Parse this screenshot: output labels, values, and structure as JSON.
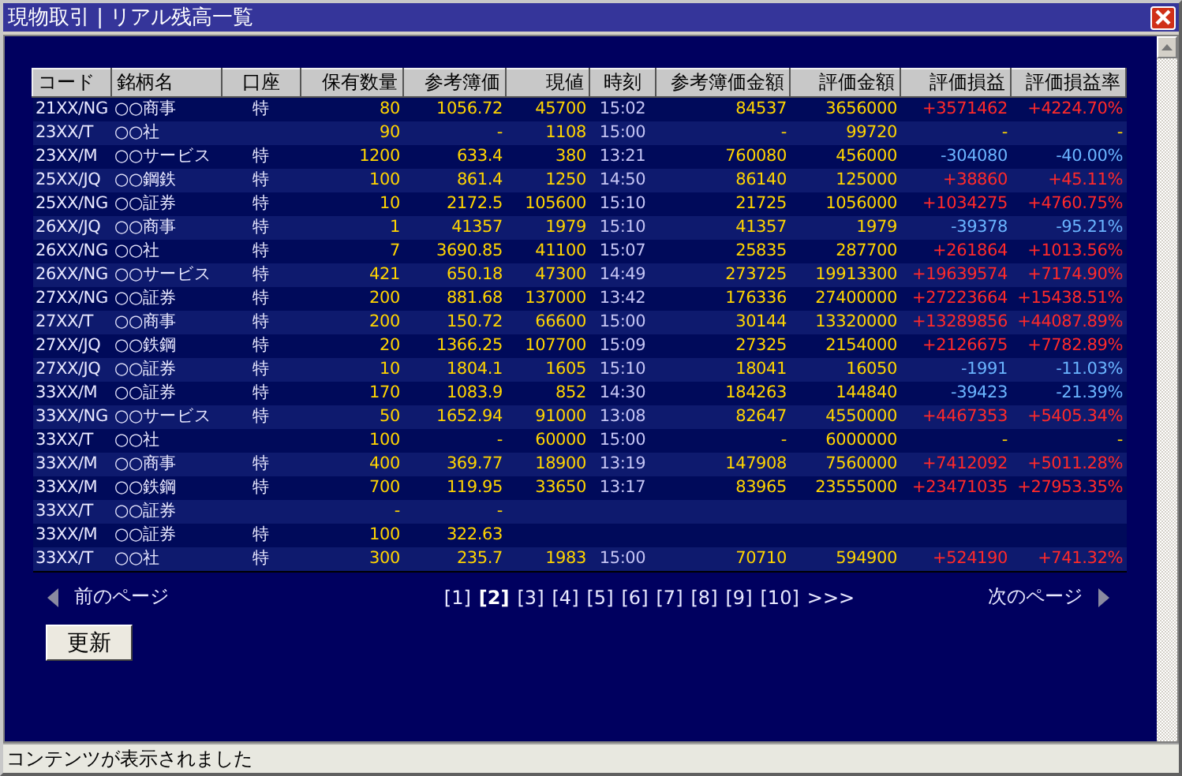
{
  "window": {
    "title": "現物取引 | リアル残高一覧"
  },
  "table": {
    "columns": [
      "コード",
      "銘柄名",
      "口座",
      "保有数量",
      "参考簿価",
      "現値",
      "時刻",
      "参考簿価金額",
      "評価金額",
      "評価損益",
      "評価損益率"
    ],
    "rows": [
      {
        "kind": "gain",
        "cells": [
          "21XX/NG",
          "○○商事",
          "特",
          "80",
          "1056.72",
          "45700",
          "15:02",
          "84537",
          "3656000",
          "+3571462",
          "+4224.70%"
        ]
      },
      {
        "kind": "flat",
        "cells": [
          "23XX/T",
          "○○社",
          null,
          "90",
          "-",
          "1108",
          "15:00",
          "-",
          "99720",
          "-",
          "-"
        ]
      },
      {
        "kind": "loss",
        "cells": [
          "23XX/M",
          "○○サービス",
          "特",
          "1200",
          "633.4",
          "380",
          "13:21",
          "760080",
          "456000",
          "-304080",
          "-40.00%"
        ]
      },
      {
        "kind": "gain",
        "cells": [
          "25XX/JQ",
          "○○鋼鉄",
          "特",
          "100",
          "861.4",
          "1250",
          "14:50",
          "86140",
          "125000",
          "+38860",
          "+45.11%"
        ]
      },
      {
        "kind": "gain",
        "cells": [
          "25XX/NG",
          "○○証券",
          "特",
          "10",
          "2172.5",
          "105600",
          "15:10",
          "21725",
          "1056000",
          "+1034275",
          "+4760.75%"
        ]
      },
      {
        "kind": "loss",
        "cells": [
          "26XX/JQ",
          "○○商事",
          "特",
          "1",
          "41357",
          "1979",
          "15:10",
          "41357",
          "1979",
          "-39378",
          "-95.21%"
        ]
      },
      {
        "kind": "gain",
        "cells": [
          "26XX/NG",
          "○○社",
          "特",
          "7",
          "3690.85",
          "41100",
          "15:07",
          "25835",
          "287700",
          "+261864",
          "+1013.56%"
        ]
      },
      {
        "kind": "gain",
        "cells": [
          "26XX/NG",
          "○○サービス",
          "特",
          "421",
          "650.18",
          "47300",
          "14:49",
          "273725",
          "19913300",
          "+19639574",
          "+7174.90%"
        ]
      },
      {
        "kind": "gain",
        "cells": [
          "27XX/NG",
          "○○証券",
          "特",
          "200",
          "881.68",
          "137000",
          "13:42",
          "176336",
          "27400000",
          "+27223664",
          "+15438.51%"
        ]
      },
      {
        "kind": "gain",
        "cells": [
          "27XX/T",
          "○○商事",
          "特",
          "200",
          "150.72",
          "66600",
          "15:00",
          "30144",
          "13320000",
          "+13289856",
          "+44087.89%"
        ]
      },
      {
        "kind": "gain",
        "cells": [
          "27XX/JQ",
          "○○鉄鋼",
          "特",
          "20",
          "1366.25",
          "107700",
          "15:09",
          "27325",
          "2154000",
          "+2126675",
          "+7782.89%"
        ]
      },
      {
        "kind": "loss",
        "cells": [
          "27XX/JQ",
          "○○証券",
          "特",
          "10",
          "1804.1",
          "1605",
          "15:10",
          "18041",
          "16050",
          "-1991",
          "-11.03%"
        ]
      },
      {
        "kind": "loss",
        "cells": [
          "33XX/M",
          "○○証券",
          "特",
          "170",
          "1083.9",
          "852",
          "14:30",
          "184263",
          "144840",
          "-39423",
          "-21.39%"
        ]
      },
      {
        "kind": "gain",
        "cells": [
          "33XX/NG",
          "○○サービス",
          "特",
          "50",
          "1652.94",
          "91000",
          "13:08",
          "82647",
          "4550000",
          "+4467353",
          "+5405.34%"
        ]
      },
      {
        "kind": "flat",
        "cells": [
          "33XX/T",
          "○○社",
          null,
          "100",
          "-",
          "60000",
          "15:00",
          "-",
          "6000000",
          "-",
          "-"
        ]
      },
      {
        "kind": "gain",
        "cells": [
          "33XX/M",
          "○○商事",
          "特",
          "400",
          "369.77",
          "18900",
          "13:19",
          "147908",
          "7560000",
          "+7412092",
          "+5011.28%"
        ]
      },
      {
        "kind": "gain",
        "cells": [
          "33XX/M",
          "○○鉄鋼",
          "特",
          "700",
          "119.95",
          "33650",
          "13:17",
          "83965",
          "23555000",
          "+23471035",
          "+27953.35%"
        ]
      },
      {
        "cells": [
          "33XX/T",
          "○○証券",
          null,
          "-",
          "-",
          null,
          null,
          null,
          null,
          null,
          null
        ]
      },
      {
        "cells": [
          "33XX/M",
          "○○証券",
          "特",
          "100",
          "322.63",
          null,
          null,
          null,
          null,
          null,
          null
        ]
      },
      {
        "kind": "gain",
        "cells": [
          "33XX/T",
          "○○社",
          "特",
          "300",
          "235.7",
          "1983",
          "15:00",
          "70710",
          "594900",
          "+524190",
          "+741.32%"
        ]
      }
    ]
  },
  "pagination": {
    "previous": "前のページ",
    "next": "次のページ",
    "more": ">>>",
    "pages": [
      {
        "label": "[1]",
        "selected": false
      },
      {
        "label": "[2]",
        "selected": true
      },
      {
        "label": "[3]",
        "selected": false
      },
      {
        "label": "[4]",
        "selected": false
      },
      {
        "label": "[5]",
        "selected": false
      },
      {
        "label": "[6]",
        "selected": false
      },
      {
        "label": "[7]",
        "selected": false
      },
      {
        "label": "[8]",
        "selected": false
      },
      {
        "label": "[9]",
        "selected": false
      },
      {
        "label": "[10]",
        "selected": false
      }
    ]
  },
  "refresh_button": "更新",
  "status_bar": "コンテンツが表示されました"
}
